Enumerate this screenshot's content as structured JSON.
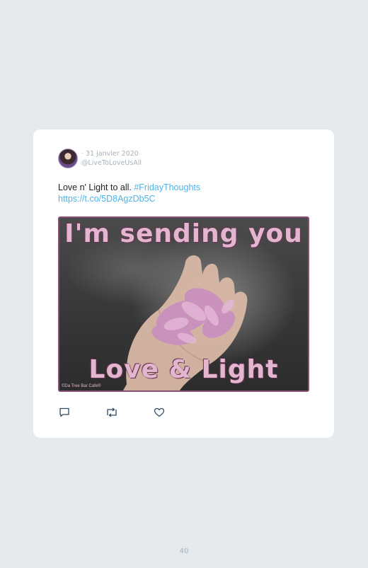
{
  "tweet": {
    "date": "· 31 janvier 2020",
    "handle": "@LiveToLoveUsAll",
    "text_plain": "Love n' Light to all. ",
    "hashtag": "#FridayThoughts",
    "link": "https://t.co/5D8AgzDb5C",
    "media": {
      "top_text": "I'm sending you",
      "bottom_text": "Love & Light",
      "credit": "©Da Tree Bar Cafe®"
    }
  },
  "actions": [
    "reply-icon",
    "retweet-icon",
    "like-icon"
  ],
  "colors": {
    "background": "#e6eaed",
    "card": "#ffffff",
    "link": "#4fb3ea",
    "muted": "#a7b2bc"
  },
  "page": {
    "number": "40"
  }
}
